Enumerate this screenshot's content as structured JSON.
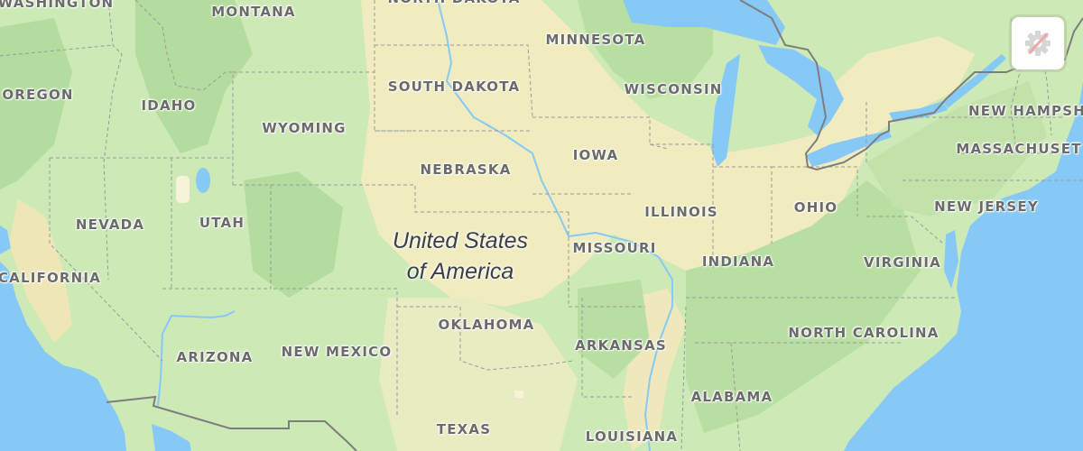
{
  "map": {
    "country_label": {
      "line1": "United States",
      "line2": "of America"
    },
    "state_labels": [
      {
        "name": "WASHINGTON",
        "key": "washington"
      },
      {
        "name": "MONTANA",
        "key": "montana"
      },
      {
        "name": "NORTH DAKOTA",
        "key": "north-dakota"
      },
      {
        "name": "MINNESOTA",
        "key": "minnesota"
      },
      {
        "name": "OREGON",
        "key": "oregon"
      },
      {
        "name": "IDAHO",
        "key": "idaho"
      },
      {
        "name": "SOUTH DAKOTA",
        "key": "south-dakota"
      },
      {
        "name": "WISCONSIN",
        "key": "wisconsin"
      },
      {
        "name": "WYOMING",
        "key": "wyoming"
      },
      {
        "name": "NEW HAMPSH",
        "key": "new-hampshire"
      },
      {
        "name": "MASSACHUSET",
        "key": "massachusetts"
      },
      {
        "name": "IOWA",
        "key": "iowa"
      },
      {
        "name": "NEBRASKA",
        "key": "nebraska"
      },
      {
        "name": "NEVADA",
        "key": "nevada"
      },
      {
        "name": "UTAH",
        "key": "utah"
      },
      {
        "name": "ILLINOIS",
        "key": "illinois"
      },
      {
        "name": "OHIO",
        "key": "ohio"
      },
      {
        "name": "NEW JERSEY",
        "key": "new-jersey"
      },
      {
        "name": "MISSOURI",
        "key": "missouri"
      },
      {
        "name": "INDIANA",
        "key": "indiana"
      },
      {
        "name": "VIRGINIA",
        "key": "virginia"
      },
      {
        "name": "CALIFORNIA",
        "key": "california"
      },
      {
        "name": "OKLAHOMA",
        "key": "oklahoma"
      },
      {
        "name": "NORTH CAROLINA",
        "key": "north-carolina"
      },
      {
        "name": "ARKANSAS",
        "key": "arkansas"
      },
      {
        "name": "ARIZONA",
        "key": "arizona"
      },
      {
        "name": "NEW MEXICO",
        "key": "new-mexico"
      },
      {
        "name": "ALABAMA",
        "key": "alabama"
      },
      {
        "name": "TEXAS",
        "key": "texas"
      },
      {
        "name": "LOUISIANA",
        "key": "louisiana"
      }
    ]
  },
  "controls": {
    "location_button": {
      "icon": "location-disabled-icon",
      "state": "disabled"
    }
  },
  "colors": {
    "water": "#86c9f7",
    "land_green": "#cde9b6",
    "land_dark_green": "#b3dc9c",
    "land_yellow": "#f2ecbe",
    "label": "#6b6b6b",
    "border": "#8a8a8a"
  }
}
